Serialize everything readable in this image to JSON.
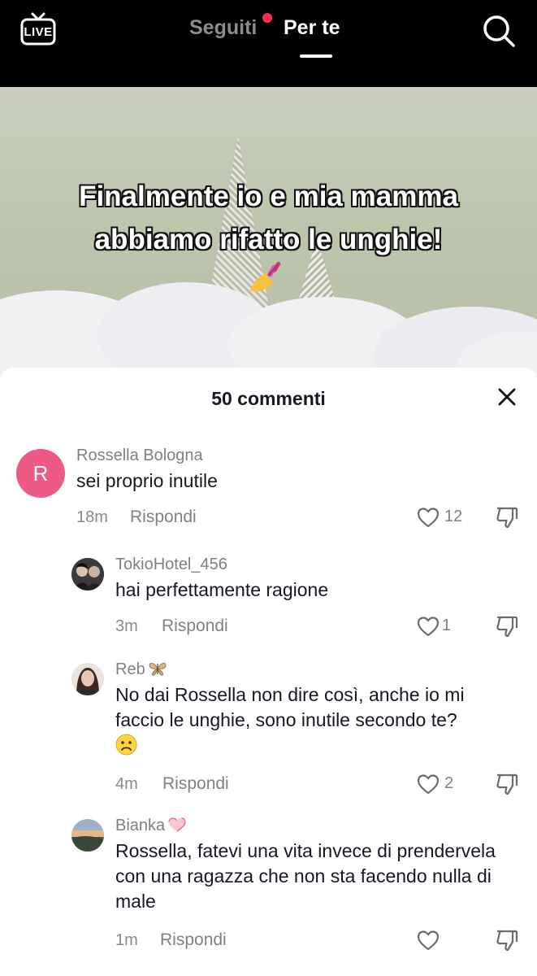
{
  "header": {
    "live_label": "LIVE",
    "tabs": [
      {
        "label": "Seguiti",
        "has_notification_dot": true,
        "active": false
      },
      {
        "label": "Per te",
        "active": true
      }
    ],
    "search_icon": "search-icon"
  },
  "video": {
    "caption_line1": "Finalmente io e mia mamma",
    "caption_line2": "abbiamo rifatto le unghie!",
    "emoji_icon": "nail-polish-icon"
  },
  "comments_panel": {
    "title": "50 commenti",
    "close_icon": "close-icon",
    "comments": [
      {
        "username": "Rossella Bologna",
        "avatar_letter": "R",
        "text": "sei proprio inutile",
        "time": "18m",
        "reply_label": "Rispondi",
        "likes": "12"
      },
      {
        "username": "TokioHotel_456",
        "text": "hai perfettamente ragione",
        "time": "3m",
        "reply_label": "Rispondi",
        "likes": "1"
      },
      {
        "username": "Reb",
        "username_badge": "butterfly-icon",
        "text": "No dai Rossella non dire così, anche io mi faccio le unghie, sono inutile secondo te?",
        "emoji": "sad-face-icon",
        "time": "4m",
        "reply_label": "Rispondi",
        "likes": "2"
      },
      {
        "username": "Bianka",
        "username_badge": "heart-icon",
        "text": "Rossella, fatevi una vita invece di prendervela con una ragazza che non sta facendo nulla di male",
        "time": "1m",
        "reply_label": "Rispondi",
        "likes": ""
      }
    ]
  },
  "colors": {
    "accent": "#fe2c55",
    "avatar_r": "#ee5a86",
    "text_primary": "#161823",
    "text_secondary": "#7f7f85"
  }
}
